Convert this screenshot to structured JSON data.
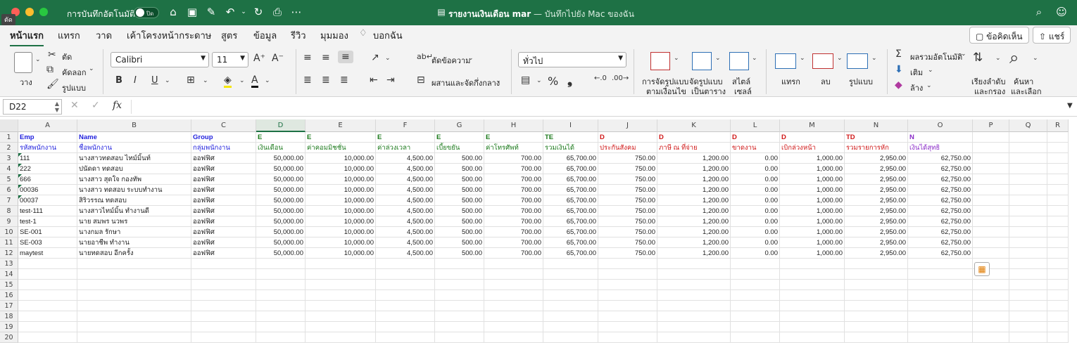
{
  "titlebar": {
    "autosave_label": "การบันทึกอัตโนมัติ",
    "autosave_state": "ปิด",
    "doc_title": "รายงานเงินเดือน mar",
    "save_location": "— บันทึกไปยัง Mac ของฉัน",
    "tooltip": "ตัด"
  },
  "tabs": [
    "หน้าแรก",
    "แทรก",
    "วาด",
    "เค้าโครงหน้ากระดาษ",
    "สูตร",
    "ข้อมูล",
    "รีวิว",
    "มุมมอง",
    "บอกฉัน"
  ],
  "comments_button": "ข้อคิดเห็น",
  "share_button": "แชร์",
  "ribbon": {
    "paste": "วาง",
    "cut": "ตัด",
    "copy": "คัดลอก",
    "format_painter": "รูปแบบ",
    "font_name": "Calibri",
    "font_size": "11",
    "bold": "B",
    "italic": "I",
    "underline": "U",
    "wrap_text": "ตัดข้อความ",
    "merge_center": "ผสานและจัดกึ่งกลาง",
    "number_format": "ทั่วไป",
    "percent": "%",
    "comma": "❟",
    "conditional_format": [
      "การจัดรูปแบบ",
      "ตามเงื่อนไข"
    ],
    "format_as_table": [
      "จัดรูปแบบ",
      "เป็นตาราง"
    ],
    "cell_styles": [
      "สไตล์",
      "เซลล์"
    ],
    "insert": "แทรก",
    "delete": "ลบ",
    "format": "รูปแบบ",
    "autosum": "ผลรวมอัตโนมัติ",
    "fill": "เติม",
    "clear": "ล้าง",
    "sort_filter": [
      "เรียงลำดับ",
      "และกรอง"
    ],
    "find_select": [
      "ค้นหา",
      "และเลือก"
    ]
  },
  "formula_bar": {
    "name_box": "D22",
    "fx": "fx",
    "formula": ""
  },
  "sheet": {
    "columns": [
      "A",
      "B",
      "C",
      "D",
      "E",
      "F",
      "G",
      "H",
      "I",
      "J",
      "K",
      "L",
      "M",
      "N",
      "O",
      "P",
      "Q",
      "R"
    ],
    "row_numbers": [
      "1",
      "2",
      "3",
      "4",
      "5",
      "6",
      "7",
      "8",
      "9",
      "10",
      "11",
      "12",
      "13",
      "14",
      "15",
      "16",
      "17",
      "18",
      "19",
      "20"
    ],
    "codes": [
      "Emp",
      "Name",
      "Group",
      "E",
      "E",
      "E",
      "E",
      "E",
      "TE",
      "D",
      "D",
      "D",
      "D",
      "TD",
      "N"
    ],
    "headers": [
      "รหัสพนักงาน",
      "ชื่อพนักงาน",
      "กลุ่มพนักงาน",
      "เงินเดือน",
      "ค่าคอมมิชชั่น",
      "ค่าล่วงเวลา",
      "เบี้ยขยัน",
      "ค่าโทรศัพท์",
      "รวมเงินได้",
      "ประกันสังคม",
      "ภาษี ณ ที่จ่าย",
      "ขาดงาน",
      "เบิกล่วงหน้า",
      "รวมรายการหัก",
      "เงินได้สุทธิ"
    ],
    "header_colors": [
      "#1f1fdd",
      "#1f1fdd",
      "#1f1fdd",
      "#1c7a1c",
      "#1c7a1c",
      "#1c7a1c",
      "#1c7a1c",
      "#1c7a1c",
      "#1c7a1c",
      "#d01818",
      "#d01818",
      "#d01818",
      "#d01818",
      "#d01818",
      "#8a2bc8"
    ],
    "rows": [
      [
        "111",
        "นางสาวทดสอบ ไทม์มิ้นท์",
        "ออฟฟิศ",
        "50,000.00",
        "10,000.00",
        "4,500.00",
        "500.00",
        "700.00",
        "65,700.00",
        "750.00",
        "1,200.00",
        "0.00",
        "1,000.00",
        "2,950.00",
        "62,750.00"
      ],
      [
        "222",
        "ปนัดดา ทดสอบ",
        "ออฟฟิศ",
        "50,000.00",
        "10,000.00",
        "4,500.00",
        "500.00",
        "700.00",
        "65,700.00",
        "750.00",
        "1,200.00",
        "0.00",
        "1,000.00",
        "2,950.00",
        "62,750.00"
      ],
      [
        "666",
        "นางสาว สุดใจ กองทัพ",
        "ออฟฟิศ",
        "50,000.00",
        "10,000.00",
        "4,500.00",
        "500.00",
        "700.00",
        "65,700.00",
        "750.00",
        "1,200.00",
        "0.00",
        "1,000.00",
        "2,950.00",
        "62,750.00"
      ],
      [
        "00036",
        "นางสาว ทดสอบ ระบบทำงาน",
        "ออฟฟิศ",
        "50,000.00",
        "10,000.00",
        "4,500.00",
        "500.00",
        "700.00",
        "65,700.00",
        "750.00",
        "1,200.00",
        "0.00",
        "1,000.00",
        "2,950.00",
        "62,750.00"
      ],
      [
        "00037",
        "สิริวรรณ ทดสอบ",
        "ออฟฟิศ",
        "50,000.00",
        "10,000.00",
        "4,500.00",
        "500.00",
        "700.00",
        "65,700.00",
        "750.00",
        "1,200.00",
        "0.00",
        "1,000.00",
        "2,950.00",
        "62,750.00"
      ],
      [
        "test-111",
        "นางสาวไทม์มิ้น ทำงานดี",
        "ออฟฟิศ",
        "50,000.00",
        "10,000.00",
        "4,500.00",
        "500.00",
        "700.00",
        "65,700.00",
        "750.00",
        "1,200.00",
        "0.00",
        "1,000.00",
        "2,950.00",
        "62,750.00"
      ],
      [
        "test-1",
        "นาย สมพร  นวพร",
        "ออฟฟิศ",
        "50,000.00",
        "10,000.00",
        "4,500.00",
        "500.00",
        "700.00",
        "65,700.00",
        "750.00",
        "1,200.00",
        "0.00",
        "1,000.00",
        "2,950.00",
        "62,750.00"
      ],
      [
        "SE-001",
        "นางกมล รักษา",
        "ออฟฟิศ",
        "50,000.00",
        "10,000.00",
        "4,500.00",
        "500.00",
        "700.00",
        "65,700.00",
        "750.00",
        "1,200.00",
        "0.00",
        "1,000.00",
        "2,950.00",
        "62,750.00"
      ],
      [
        "SE-003",
        "นายอาชีพ ทำงาน",
        "ออฟฟิศ",
        "50,000.00",
        "10,000.00",
        "4,500.00",
        "500.00",
        "700.00",
        "65,700.00",
        "750.00",
        "1,200.00",
        "0.00",
        "1,000.00",
        "2,950.00",
        "62,750.00"
      ],
      [
        "maytest",
        "นายทดสอบ อีกครั้ง",
        "ออฟฟิศ",
        "50,000.00",
        "10,000.00",
        "4,500.00",
        "500.00",
        "700.00",
        "65,700.00",
        "750.00",
        "1,200.00",
        "0.00",
        "1,000.00",
        "2,950.00",
        "62,750.00"
      ]
    ]
  }
}
